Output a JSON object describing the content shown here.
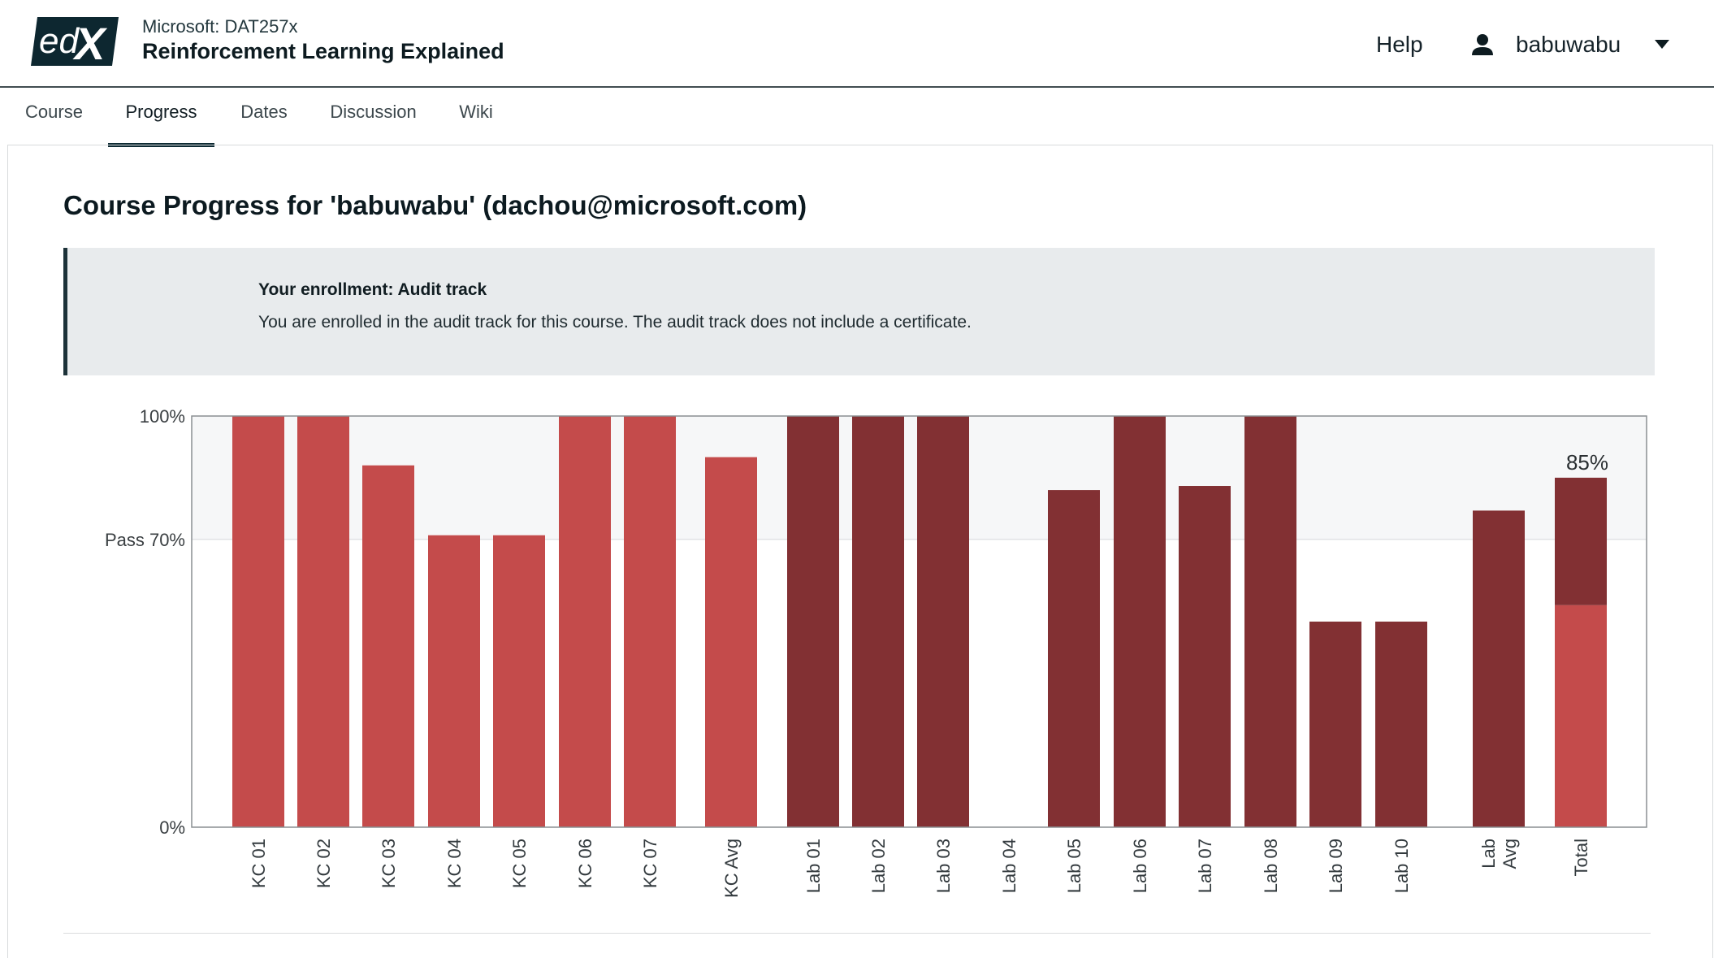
{
  "header": {
    "org": "Microsoft: DAT257x",
    "course_title": "Reinforcement Learning Explained",
    "logo_text": "edX",
    "help_label": "Help",
    "username": "babuwabu"
  },
  "tabs": [
    {
      "label": "Course",
      "active": false
    },
    {
      "label": "Progress",
      "active": true
    },
    {
      "label": "Dates",
      "active": false
    },
    {
      "label": "Discussion",
      "active": false
    },
    {
      "label": "Wiki",
      "active": false
    }
  ],
  "main": {
    "heading": "Course Progress for 'babuwabu' (dachou@microsoft.com)",
    "enrollment_title": "Your enrollment: Audit track",
    "enrollment_text": "You are enrolled in the audit track for this course. The audit track does not include a certificate."
  },
  "colors": {
    "kc": "#c44b4b",
    "lab": "#823033",
    "pass_band": "#f6f7f8",
    "accent": "#0f2b34"
  },
  "chart_data": {
    "type": "bar",
    "ylabels": {
      "top": "100%",
      "pass": "Pass 70%",
      "bottom": "0%"
    },
    "ylim": [
      0,
      100
    ],
    "pass_mark": 70,
    "total_label": "85%",
    "grid": false,
    "categories": [
      "KC 01",
      "KC 02",
      "KC 03",
      "KC 04",
      "KC 05",
      "KC 06",
      "KC 07",
      "KC Avg",
      "Lab 01",
      "Lab 02",
      "Lab 03",
      "Lab 04",
      "Lab 05",
      "Lab 06",
      "Lab 07",
      "Lab 08",
      "Lab 09",
      "Lab 10",
      "Lab Avg",
      "Total"
    ],
    "values": [
      100,
      100,
      88,
      71,
      71,
      100,
      100,
      90,
      100,
      100,
      100,
      0,
      82,
      100,
      83,
      100,
      50,
      50,
      77,
      85
    ],
    "groups": [
      "kc",
      "kc",
      "kc",
      "kc",
      "kc",
      "kc",
      "kc",
      "kc",
      "lab",
      "lab",
      "lab",
      "lab",
      "lab",
      "lab",
      "lab",
      "lab",
      "lab",
      "lab",
      "lab",
      "total"
    ],
    "total_segments": [
      {
        "group": "kc",
        "value": 54
      },
      {
        "group": "lab",
        "value": 31
      }
    ]
  }
}
